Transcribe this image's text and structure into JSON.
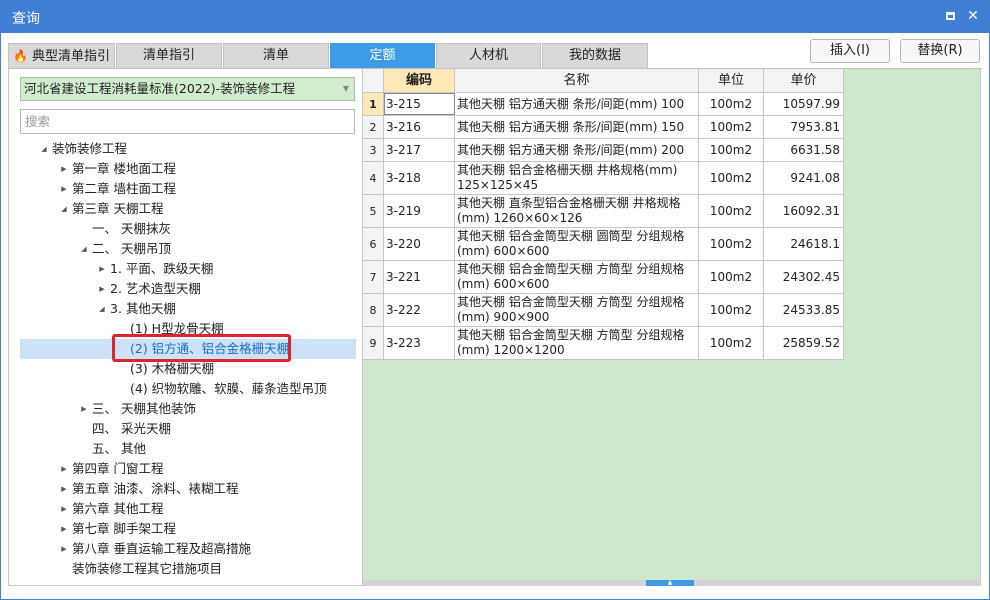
{
  "window": {
    "title": "查询"
  },
  "tabs": [
    {
      "label": "典型清单指引",
      "active": false
    },
    {
      "label": "清单指引",
      "active": false
    },
    {
      "label": "清单",
      "active": false
    },
    {
      "label": "定额",
      "active": true
    },
    {
      "label": "人材机",
      "active": false
    },
    {
      "label": "我的数据",
      "active": false
    }
  ],
  "actions": {
    "insert_label": "插入(I)",
    "replace_label": "替换(R)"
  },
  "left": {
    "standard": "河北省建设工程消耗量标准(2022)-装饰装修工程",
    "search_placeholder": "搜索",
    "tree": [
      {
        "label": "装饰装修工程",
        "expander": "open",
        "level": 0
      },
      {
        "label": "第一章 楼地面工程",
        "expander": "closed",
        "level": 1
      },
      {
        "label": "第二章 墙柱面工程",
        "expander": "closed",
        "level": 1
      },
      {
        "label": "第三章 天棚工程",
        "expander": "open",
        "level": 1
      },
      {
        "label": "一、 天棚抹灰",
        "expander": "none",
        "level": 2
      },
      {
        "label": "二、 天棚吊顶",
        "expander": "open",
        "level": 2
      },
      {
        "label": "1. 平面、跌级天棚",
        "expander": "closed",
        "level": 3
      },
      {
        "label": "2. 艺术造型天棚",
        "expander": "closed",
        "level": 3
      },
      {
        "label": "3. 其他天棚",
        "expander": "open",
        "level": 3
      },
      {
        "label": "(1) H型龙骨天棚",
        "expander": "none",
        "level": 4
      },
      {
        "label": "(2) 铝方通、铝合金格栅天棚",
        "expander": "none",
        "level": 4,
        "selected": true
      },
      {
        "label": "(3) 木格栅天棚",
        "expander": "none",
        "level": 4
      },
      {
        "label": "(4) 织物软雕、软膜、藤条造型吊顶",
        "expander": "none",
        "level": 4
      },
      {
        "label": "三、 天棚其他装饰",
        "expander": "closed",
        "level": 2
      },
      {
        "label": "四、 采光天棚",
        "expander": "none",
        "level": 2
      },
      {
        "label": "五、 其他",
        "expander": "none",
        "level": 2
      },
      {
        "label": "第四章 门窗工程",
        "expander": "closed",
        "level": 1
      },
      {
        "label": "第五章 油漆、涂料、裱糊工程",
        "expander": "closed",
        "level": 1
      },
      {
        "label": "第六章 其他工程",
        "expander": "closed",
        "level": 1
      },
      {
        "label": "第七章 脚手架工程",
        "expander": "closed",
        "level": 1
      },
      {
        "label": "第八章 垂直运输工程及超高措施",
        "expander": "closed",
        "level": 1
      },
      {
        "label": "装饰装修工程其它措施项目",
        "expander": "none",
        "level": 1
      }
    ]
  },
  "grid": {
    "headers": {
      "code": "编码",
      "name": "名称",
      "unit": "单位",
      "price": "单价"
    },
    "rows": [
      {
        "idx": "1",
        "code": "3-215",
        "name": "其他天棚 铝方通天棚 条形/间距(mm) 100",
        "unit": "100m2",
        "price": "10597.99"
      },
      {
        "idx": "2",
        "code": "3-216",
        "name": "其他天棚 铝方通天棚 条形/间距(mm) 150",
        "unit": "100m2",
        "price": "7953.81"
      },
      {
        "idx": "3",
        "code": "3-217",
        "name": "其他天棚 铝方通天棚 条形/间距(mm) 200",
        "unit": "100m2",
        "price": "6631.58"
      },
      {
        "idx": "4",
        "code": "3-218",
        "name": "其他天棚 铝合金格栅天棚 井格规格(mm) 125×125×45",
        "unit": "100m2",
        "price": "9241.08"
      },
      {
        "idx": "5",
        "code": "3-219",
        "name": "其他天棚 直条型铝合金格栅天棚 井格规格(mm) 1260×60×126",
        "unit": "100m2",
        "price": "16092.31"
      },
      {
        "idx": "6",
        "code": "3-220",
        "name": "其他天棚 铝合金筒型天棚 圆筒型 分组规格(mm) 600×600",
        "unit": "100m2",
        "price": "24618.1"
      },
      {
        "idx": "7",
        "code": "3-221",
        "name": "其他天棚 铝合金筒型天棚 方筒型 分组规格(mm) 600×600",
        "unit": "100m2",
        "price": "24302.45"
      },
      {
        "idx": "8",
        "code": "3-222",
        "name": "其他天棚 铝合金筒型天棚 方筒型 分组规格(mm) 900×900",
        "unit": "100m2",
        "price": "24533.85"
      },
      {
        "idx": "9",
        "code": "3-223",
        "name": "其他天棚 铝合金筒型天棚 方筒型 分组规格(mm) 1200×1200",
        "unit": "100m2",
        "price": "25859.52"
      }
    ]
  }
}
